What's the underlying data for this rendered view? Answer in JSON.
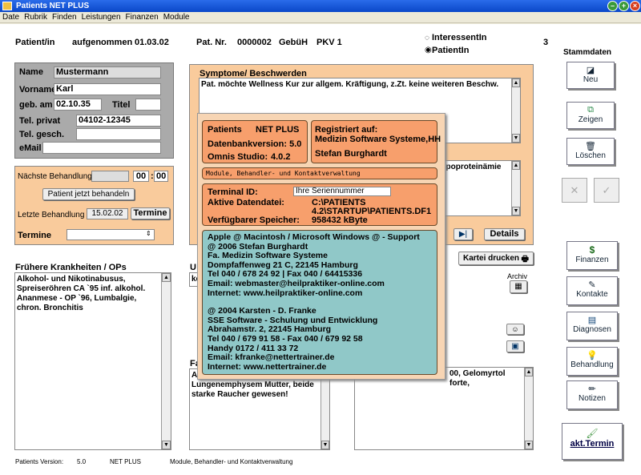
{
  "window": {
    "title": "Patients NET PLUS"
  },
  "menu": [
    "Date",
    "Rubrik",
    "Finden",
    "Leistungen",
    "Finanzen",
    "Module"
  ],
  "header": {
    "patient_label": "Patient/in",
    "aufgenommen_label": "aufgenommen",
    "aufgenommen_value": "01.03.02",
    "pat_nr_label": "Pat. Nr.",
    "pat_nr_value": "0000002",
    "gebuh_label": "GebüH",
    "gebuh_value": "PKV 1",
    "radio_interessent": "InteressentIn",
    "radio_patient": "PatientIn",
    "count": "3"
  },
  "patient": {
    "name_label": "Name",
    "name_value": "Mustermann",
    "vorname_label": "Vorname",
    "vorname_value": "Karl",
    "geb_label": "geb. am",
    "geb_value": "02.10.35",
    "titel_label": "Titel",
    "titel_value": "",
    "tel_privat_label": "Tel. privat",
    "tel_privat_value": "04102-12345",
    "tel_gesch_label": "Tel. gesch.",
    "tel_gesch_value": "",
    "email_label": "eMail",
    "email_value": ""
  },
  "behandlung": {
    "naechste_label": "Nächste Behandlung",
    "time_h": "00",
    "time_m": "00",
    "jetzt_button": "Patient jetzt behandeln",
    "letzte_label": "Letzte Behandlung",
    "letzte_value": "15.02.02",
    "termine_button": "Termine",
    "termine_label": "Termine",
    "termine_select": ""
  },
  "fruehere": {
    "label": "Frühere Krankheiten / OPs",
    "text": "Alkohol- und Nikotinabusus, Spreiseröhren CA `95 inf.  alkohol. Ananmese - OP `96, Lumbalgie, chron. Bronchitis"
  },
  "unter": {
    "label": "U",
    "text": "ke"
  },
  "family": {
    "label": "Fa",
    "text_prefix": "As",
    "text": "Lungenemphysem Mutter, beide starke Raucher gewesen!"
  },
  "symptome": {
    "label": "Symptome/ Beschwerden",
    "text": "Pat. möchte Wellness Kur zur allgem. Kräftigung, z.Zt. keine weiteren Beschw."
  },
  "befund": {
    "text": "lipoproteinämie"
  },
  "details_button": "Details",
  "kartei_button": "Kartei drucken",
  "archiv_label": "Archiv",
  "medikation": {
    "text": "00, Gelomyrtol forte,"
  },
  "sidebar": {
    "stammdaten": "Stammdaten",
    "neu": "Neu",
    "zeigen": "Zeigen",
    "loeschen": "Löschen",
    "finanzen": "Finanzen",
    "kontakte": "Kontakte",
    "diagnosen": "Diagnosen",
    "behandlung": "Behandlung",
    "notizen": "Notizen",
    "akt_termin": "akt.Termin"
  },
  "about": {
    "patients": "Patients",
    "net_plus": "NET PLUS",
    "db_version": "Datenbankversion: 5.0",
    "omnis": "Omnis Studio:",
    "omnis_version": "4.0.2",
    "registriert_label": "Registriert auf:",
    "registriert_firma": "Medizin Software Systeme,HH",
    "registriert_name": "Stefan Burghardt",
    "module": "Module, Behandler- und Kontaktverwaltung",
    "terminal_label": "Terminal ID:",
    "terminal_value": "Ihre Seriennummer",
    "datei_label": "Aktive Datendatei:",
    "datei_value_1": "C:\\PATIENTS",
    "datei_value_2": "4.2\\STARTUP\\PATIENTS.DF1",
    "speicher_label": "Verfügbarer Speicher:",
    "speicher_value": "958432 kByte",
    "credits": [
      "Apple @ Macintosh / Microsoft Windows @ - Support",
      "@ 2006 Stefan Burghardt",
      "Fa. Medizin Software Systeme",
      "Dompfaffenweg 21 C, 22145 Hamburg",
      "Tel 040 / 678 24 92  |  Fax 040 / 64415336",
      "Email: webmaster@heilpraktiker-online.com",
      "Internet: www.heilpraktiker-online.com",
      "",
      "@ 2004 Karsten - D. Franke",
      "SSE Software - Schulung und Entwicklung",
      "Abrahamstr. 2, 22145 Hamburg",
      "Tel 040 / 679 91 58 - Fax 040 / 679 92 58",
      "Handy 0172 / 411 33 72",
      "Email: kfranke@nettertrainer.de",
      "Internet: www.nettertrainer.de"
    ]
  },
  "footer": {
    "version_label": "Patients Version:",
    "version_value": "5.0",
    "product": "NET PLUS",
    "module": "Module, Behandler- und Kontaktverwaltung"
  }
}
